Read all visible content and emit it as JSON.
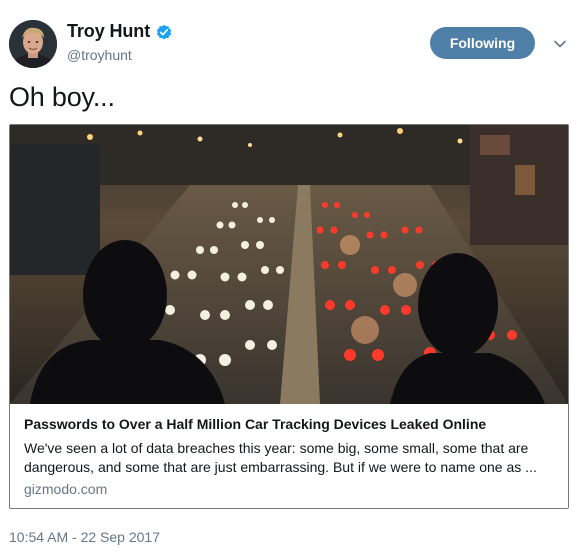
{
  "author": {
    "display_name": "Troy Hunt",
    "handle": "@troyhunt",
    "verified": true,
    "avatar_icon": "profile-photo"
  },
  "follow_button": {
    "label": "Following",
    "color": "#4f7fa6"
  },
  "more_menu": {
    "icon": "chevron-down-icon"
  },
  "tweet": {
    "text": "Oh boy..."
  },
  "card": {
    "image_description_icon": "traffic-night-photo",
    "title": "Passwords to Over a Half Million Car Tracking Devices Leaked Online",
    "description": "We've seen a lot of data breaches this year: some big, some small, some that are dangerous, and some that are just embarrassing. But if we were to name one as ...",
    "domain": "gizmodo.com"
  },
  "timestamp": "10:54 AM - 22 Sep 2017",
  "colors": {
    "text_primary": "#14171a",
    "text_secondary": "#657786",
    "verified_blue": "#1da1f2"
  }
}
